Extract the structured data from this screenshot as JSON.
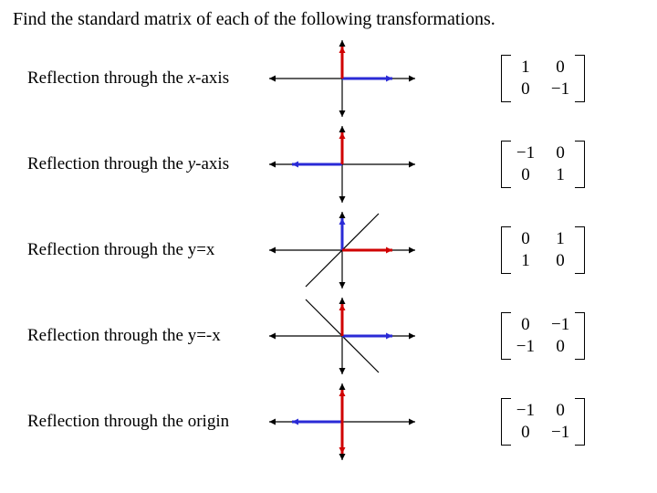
{
  "title": "Find the standard matrix of each of the following transformations.",
  "rows": [
    {
      "label_pre": "Reflection through the ",
      "label_var": "x",
      "label_post": "-axis",
      "matrix": {
        "a": "1",
        "b": "0",
        "c": "0",
        "d": "−1"
      },
      "plot": {
        "red_dx": 0,
        "red_dy": -35,
        "blue_dx": 55,
        "blue_dy": 0,
        "extra_line": null
      }
    },
    {
      "label_pre": "Reflection through the ",
      "label_var": "y",
      "label_post": "-axis",
      "matrix": {
        "a": "−1",
        "b": "0",
        "c": "0",
        "d": "1"
      },
      "plot": {
        "red_dx": 0,
        "red_dy": -35,
        "blue_dx": -55,
        "blue_dy": 0,
        "extra_line": null
      }
    },
    {
      "label_pre": "Reflection through the ",
      "label_var": "",
      "label_post": "y=x",
      "matrix": {
        "a": "0",
        "b": "1",
        "c": "1",
        "d": "0"
      },
      "plot": {
        "red_dx": 55,
        "red_dy": 0,
        "blue_dx": 0,
        "blue_dy": -35,
        "extra_line": "yx"
      }
    },
    {
      "label_pre": "Reflection through the ",
      "label_var": "",
      "label_post": "y=-x",
      "matrix": {
        "a": "0",
        "b": "−1",
        "c": "−1",
        "d": "0"
      },
      "plot": {
        "red_dx": 0,
        "red_dy": -35,
        "blue_dx": 55,
        "blue_dy": 0,
        "extra_line": "ymx"
      }
    },
    {
      "label_pre": "Reflection through the ",
      "label_var": "",
      "label_post": "origin",
      "matrix": {
        "a": "−1",
        "b": "0",
        "c": "0",
        "d": "−1"
      },
      "plot": {
        "red_dx": 0,
        "red_dy": 35,
        "blue_dx": -55,
        "blue_dy": 0,
        "extra_line": null,
        "red_up_too": true
      }
    }
  ]
}
